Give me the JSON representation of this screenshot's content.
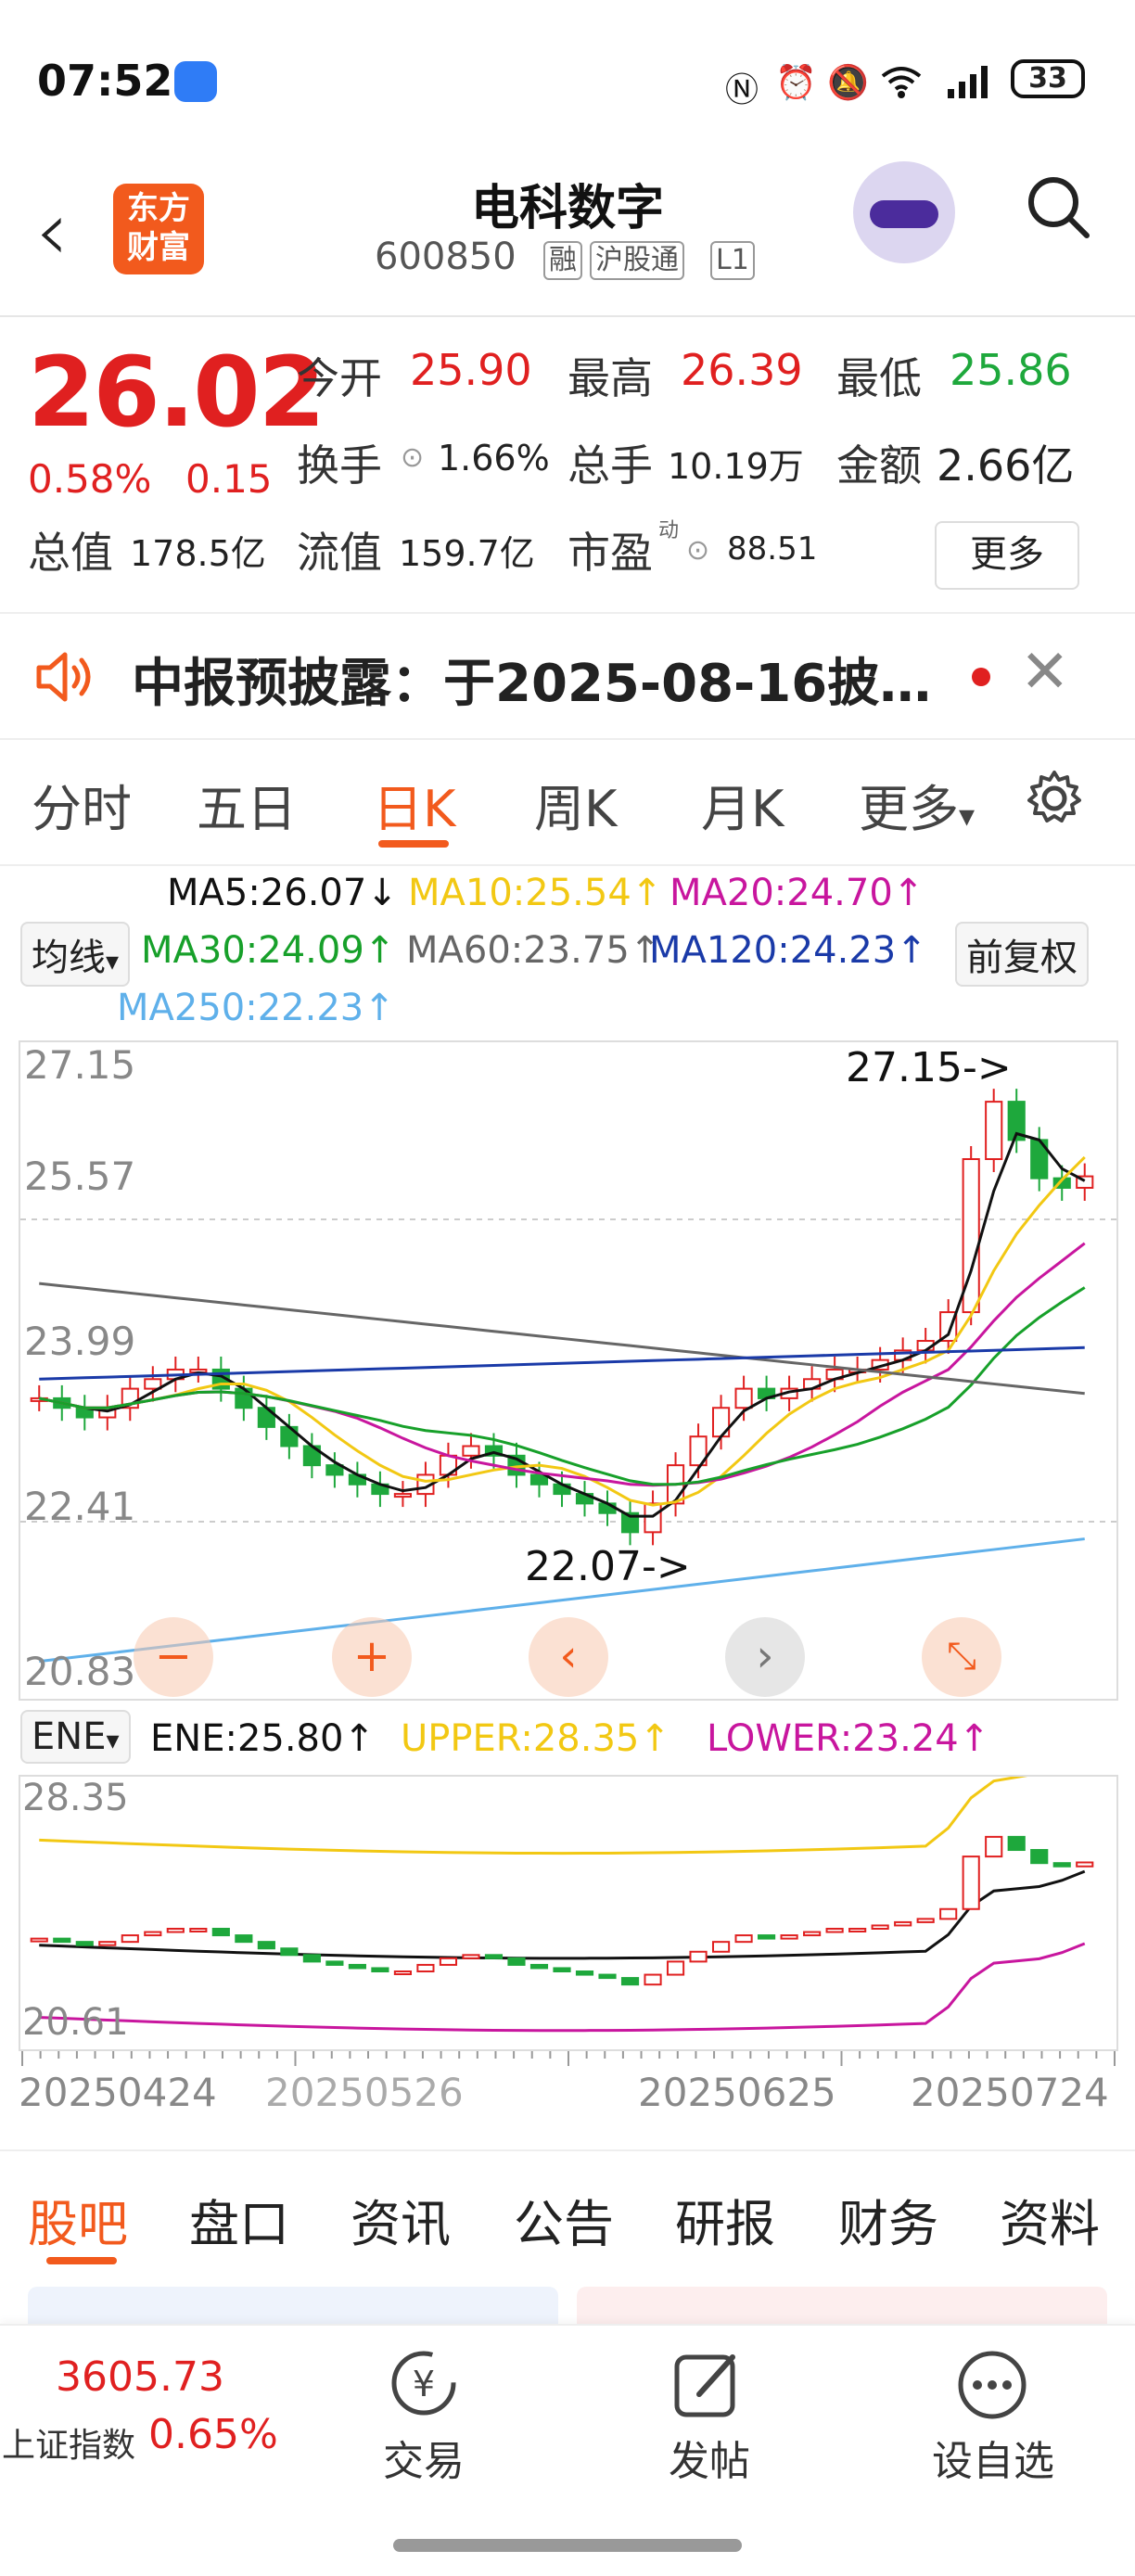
{
  "status_bar": {
    "time": "07:52",
    "battery": "33"
  },
  "header": {
    "logo_line1": "东方",
    "logo_line2": "财富",
    "stock_name": "电科数字",
    "stock_code": "600850",
    "tags": [
      "融",
      "沪股通",
      "L1"
    ]
  },
  "quote": {
    "price": "26.02",
    "change_pct": "0.58%",
    "change": "0.15",
    "rows": [
      [
        {
          "label": "今开",
          "value": "25.90",
          "color": "red"
        },
        {
          "label": "最高",
          "value": "26.39",
          "color": "red"
        },
        {
          "label": "最低",
          "value": "25.86",
          "color": "green"
        }
      ],
      [
        {
          "label": "换手",
          "value": "1.66%",
          "color": "dark"
        },
        {
          "label": "总手",
          "value": "10.19万",
          "color": "dark"
        },
        {
          "label": "金额",
          "value": "2.66亿",
          "color": "dark"
        }
      ],
      [
        {
          "label": "总值",
          "value": "178.5亿",
          "color": "dark"
        },
        {
          "label": "流值",
          "value": "159.7亿",
          "color": "dark"
        },
        {
          "label": "市盈",
          "value": "88.51",
          "color": "dark"
        }
      ]
    ],
    "pe_superscript": "动",
    "more_button": "更多"
  },
  "announcement": {
    "text": "中报预披露：于2025-08-16披…"
  },
  "period_tabs": {
    "items": [
      "分时",
      "五日",
      "日K",
      "周K",
      "月K"
    ],
    "more": "更多",
    "active": "日K"
  },
  "ma_legend": {
    "ma5": "MA5:26.07",
    "ma10": "MA10:25.54",
    "ma20": "MA20:24.70",
    "ma30": "MA30:24.09",
    "ma60": "MA60:23.75",
    "ma120": "MA120:24.23",
    "ma250": "MA250:22.23",
    "indicator_select": "均线",
    "adjust_button": "前复权"
  },
  "kchart": {
    "y_labels": [
      "27.15",
      "25.57",
      "23.99",
      "22.41",
      "20.83"
    ],
    "high_annotation": "27.15->",
    "low_annotation": "22.07->"
  },
  "ene_legend": {
    "select": "ENE",
    "ene": "ENE:25.80",
    "upper": "UPPER:28.35",
    "lower": "LOWER:23.24"
  },
  "ene_chart": {
    "y_top": "28.35",
    "y_bottom": "20.61"
  },
  "date_axis": [
    "20250424",
    "20250526",
    "20250625",
    "20250724"
  ],
  "colors": {
    "rise": "#e02020",
    "fall": "#1ea83c",
    "ma5": "#111111",
    "ma10": "#f2c813",
    "ma20": "#c8169e",
    "ma30": "#17a02a",
    "ma60": "#666666",
    "ma120": "#1a3aa8",
    "ma250": "#5fb0ea",
    "accent": "#f25a1d"
  },
  "sub_tabs": {
    "items": [
      "股吧",
      "盘口",
      "资讯",
      "公告",
      "研报",
      "财务",
      "资料"
    ],
    "active": "股吧"
  },
  "bottom_nav": {
    "index_value": "3605.73",
    "index_name": "上证指数",
    "index_change": "0.65%",
    "trade": "交易",
    "post": "发帖",
    "watchlist": "设自选"
  },
  "chart_data": {
    "type": "candlestick",
    "series": [
      {
        "name": "MA5",
        "value": 26.07
      },
      {
        "name": "MA10",
        "value": 25.54
      },
      {
        "name": "MA20",
        "value": 24.7
      },
      {
        "name": "MA30",
        "value": 24.09
      },
      {
        "name": "MA60",
        "value": 23.75
      },
      {
        "name": "MA120",
        "value": 24.23
      },
      {
        "name": "MA250",
        "value": 22.23
      }
    ],
    "ylim": [
      20.83,
      27.15
    ],
    "y_ticks": [
      27.15,
      25.57,
      23.99,
      22.41,
      20.83
    ],
    "x_ticks": [
      "20250424",
      "20250526",
      "20250625",
      "20250724"
    ],
    "annotations": [
      {
        "text": "27.15->",
        "value": 27.15
      },
      {
        "text": "22.07->",
        "value": 22.07
      }
    ],
    "ene": {
      "ENE": 25.8,
      "UPPER": 28.35,
      "LOWER": 23.24,
      "ylim": [
        20.61,
        28.35
      ]
    }
  }
}
